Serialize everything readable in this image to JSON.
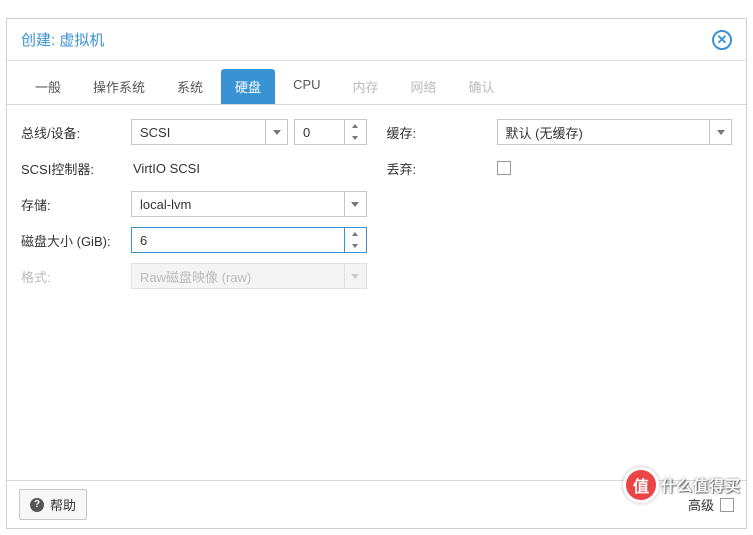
{
  "header": {
    "title": "创建: 虚拟机"
  },
  "tabs": [
    {
      "label": "一般",
      "state": "normal"
    },
    {
      "label": "操作系统",
      "state": "normal"
    },
    {
      "label": "系统",
      "state": "normal"
    },
    {
      "label": "硬盘",
      "state": "active"
    },
    {
      "label": "CPU",
      "state": "normal"
    },
    {
      "label": "内存",
      "state": "disabled"
    },
    {
      "label": "网络",
      "state": "disabled"
    },
    {
      "label": "确认",
      "state": "disabled"
    }
  ],
  "left": {
    "bus_device": {
      "label": "总线/设备:",
      "bus": "SCSI",
      "index": "0"
    },
    "scsi_controller": {
      "label": "SCSI控制器:",
      "value": "VirtIO SCSI"
    },
    "storage": {
      "label": "存储:",
      "value": "local-lvm"
    },
    "disk_size": {
      "label": "磁盘大小 (GiB):",
      "value": "6"
    },
    "format": {
      "label": "格式:",
      "value": "Raw磁盘映像 (raw)"
    }
  },
  "right": {
    "cache": {
      "label": "缓存:",
      "value": "默认 (无缓存)"
    },
    "discard": {
      "label": "丢弃:"
    }
  },
  "footer": {
    "help": "帮助",
    "advanced": "高级"
  },
  "watermark": {
    "badge": "值",
    "text": "什么值得买"
  }
}
